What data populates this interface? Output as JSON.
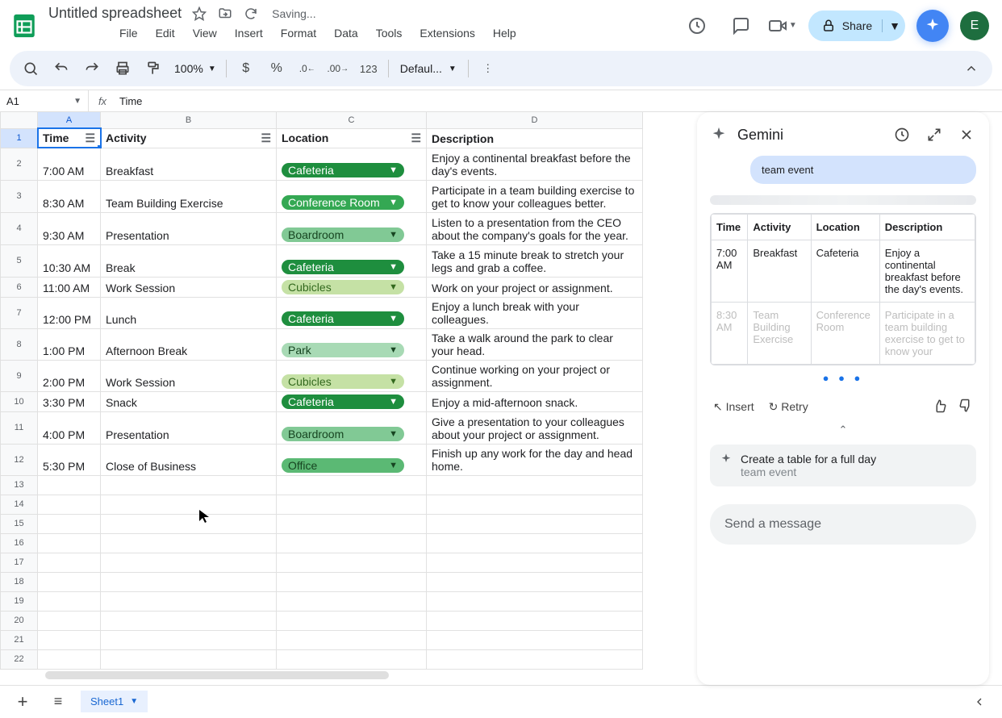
{
  "doc": {
    "title": "Untitled spreadsheet",
    "saving": "Saving..."
  },
  "share_label": "Share",
  "avatar_letter": "E",
  "menus": [
    "File",
    "Edit",
    "View",
    "Insert",
    "Format",
    "Data",
    "Tools",
    "Extensions",
    "Help"
  ],
  "zoom": "100%",
  "font": "Defaul...",
  "fmt123": "123",
  "namebox": "A1",
  "fxval": "Time",
  "cols": [
    "A",
    "B",
    "C",
    "D"
  ],
  "headers": {
    "a": "Time",
    "b": "Activity",
    "c": "Location",
    "d": "Description"
  },
  "rows": [
    {
      "t": "7:00 AM",
      "a": "Breakfast",
      "l": "Cafeteria",
      "lc": "cafeteria",
      "d": "Enjoy a continental breakfast before the day's events."
    },
    {
      "t": "8:30 AM",
      "a": "Team Building Exercise",
      "l": "Conference Room",
      "lc": "conf",
      "d": "Participate in a team building exercise to get to know your colleagues better."
    },
    {
      "t": "9:30 AM",
      "a": "Presentation",
      "l": "Boardroom",
      "lc": "board",
      "d": "Listen to a presentation from the CEO about the company's goals for the year."
    },
    {
      "t": "10:30 AM",
      "a": "Break",
      "l": "Cafeteria",
      "lc": "cafeteria",
      "d": "Take a 15 minute break to stretch your legs and grab a coffee."
    },
    {
      "t": "11:00 AM",
      "a": "Work Session",
      "l": "Cubicles",
      "lc": "cubicles",
      "d": "Work on your project or assignment."
    },
    {
      "t": "12:00 PM",
      "a": "Lunch",
      "l": "Cafeteria",
      "lc": "cafeteria",
      "d": "Enjoy a lunch break with your colleagues."
    },
    {
      "t": "1:00 PM",
      "a": "Afternoon Break",
      "l": "Park",
      "lc": "park",
      "d": "Take a walk around the park to clear your head."
    },
    {
      "t": "2:00 PM",
      "a": "Work Session",
      "l": "Cubicles",
      "lc": "cubicles",
      "d": "Continue working on your project or assignment."
    },
    {
      "t": "3:30 PM",
      "a": "Snack",
      "l": "Cafeteria",
      "lc": "cafeteria",
      "d": "Enjoy a mid-afternoon snack."
    },
    {
      "t": "4:00 PM",
      "a": "Presentation",
      "l": "Boardroom",
      "lc": "board",
      "d": "Give a presentation to your colleagues about your project or assignment."
    },
    {
      "t": "5:30 PM",
      "a": "Close of Business",
      "l": "Office",
      "lc": "office",
      "d": "Finish up any work for the day and head home."
    }
  ],
  "gemini": {
    "title": "Gemini",
    "bubble": "team event",
    "th": [
      "Time",
      "Activity",
      "Location",
      "Description"
    ],
    "r1": [
      "7:00 AM",
      "Breakfast",
      "Cafeteria",
      "Enjoy a continental breakfast before the day's events."
    ],
    "r2": [
      "8:30 AM",
      "Team Building Exercise",
      "Conference Room",
      "Participate in a team building exercise to get to know your"
    ],
    "insert": "Insert",
    "retry": "Retry",
    "sugg1": "Create a table for a full day",
    "sugg2": "team event",
    "compose": "Send a message"
  },
  "sheet_tab": "Sheet1"
}
